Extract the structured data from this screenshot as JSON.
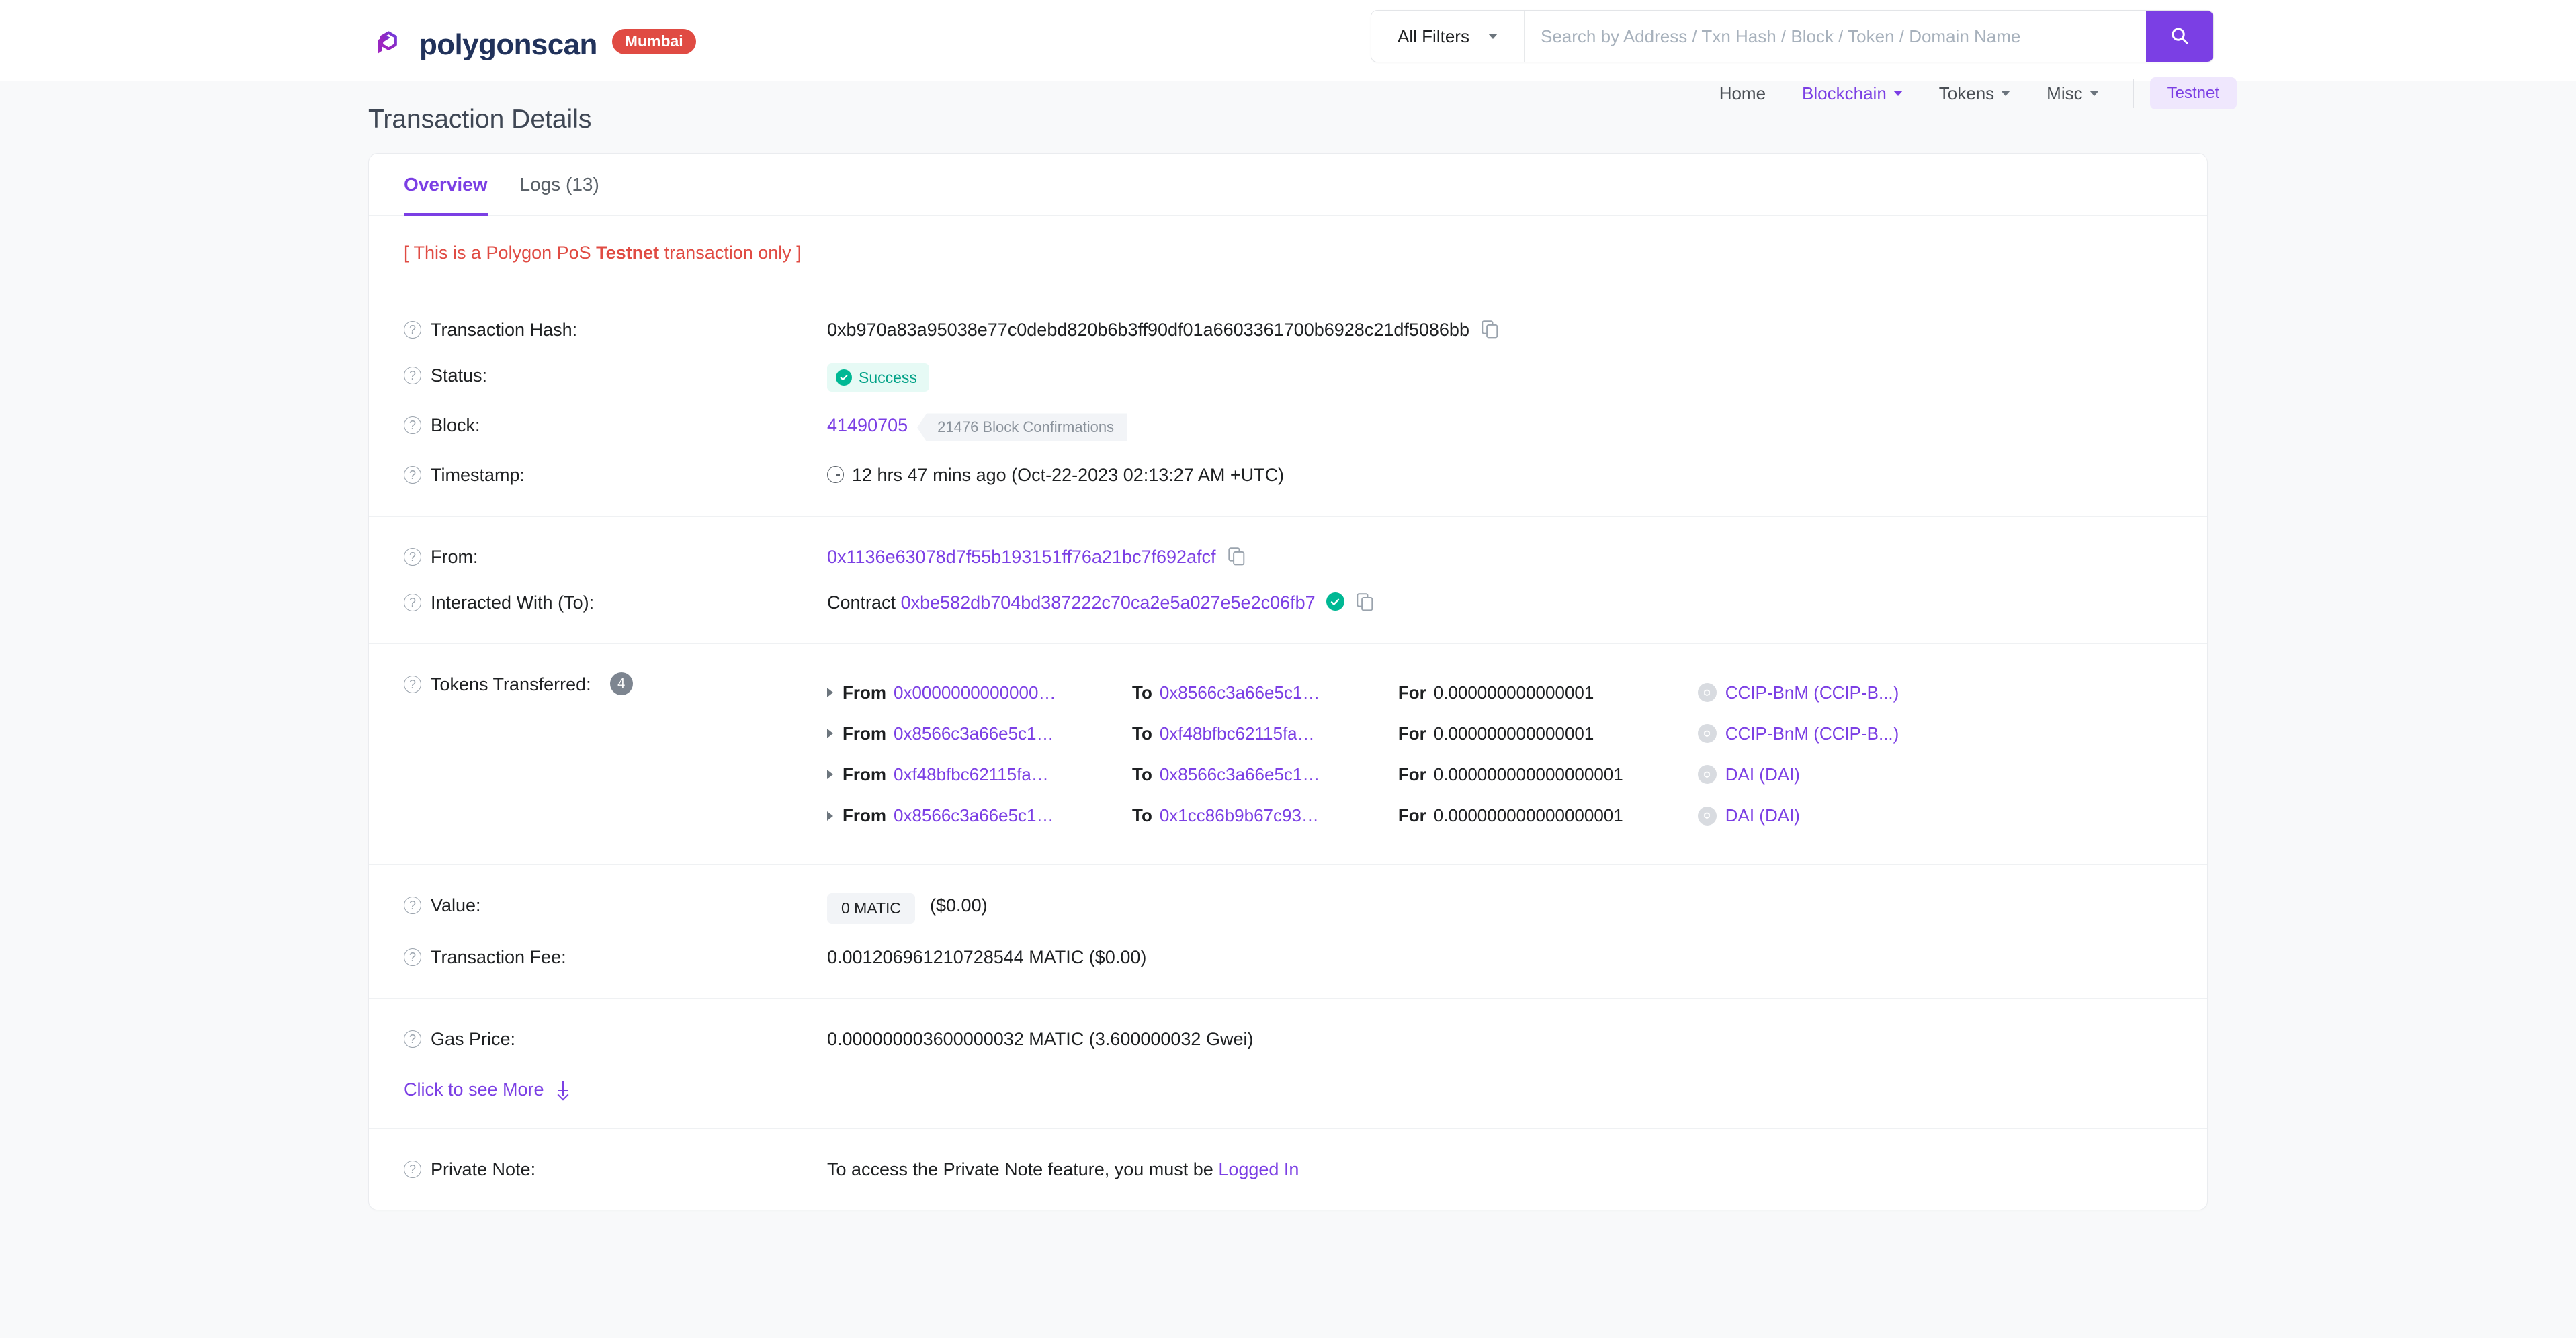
{
  "brand": {
    "name": "polygonscan",
    "network_badge": "Mumbai",
    "logo_icon": "polygon-logo-icon"
  },
  "search": {
    "filter_label": "All Filters",
    "placeholder": "Search by Address / Txn Hash / Block / Token / Domain Name",
    "value": "",
    "button_icon": "search-icon"
  },
  "nav": {
    "items": [
      {
        "label": "Home",
        "has_caret": false,
        "active": false
      },
      {
        "label": "Blockchain",
        "has_caret": true,
        "active": true
      },
      {
        "label": "Tokens",
        "has_caret": true,
        "active": false
      },
      {
        "label": "Misc",
        "has_caret": true,
        "active": false
      }
    ],
    "testnet_pill": "Testnet"
  },
  "page": {
    "title": "Transaction Details"
  },
  "tabs": [
    {
      "label": "Overview",
      "active": true
    },
    {
      "label": "Logs (13)",
      "active": false
    }
  ],
  "notice": {
    "prefix": "[ This is a Polygon PoS ",
    "strong": "Testnet",
    "suffix": " transaction only ]"
  },
  "details": {
    "transaction_hash": {
      "label": "Transaction Hash:",
      "value": "0xb970a83a95038e77c0debd820b6b3ff90df01a6603361700b6928c21df5086bb"
    },
    "status": {
      "label": "Status:",
      "value": "Success"
    },
    "block": {
      "label": "Block:",
      "number": "41490705",
      "confirmations": "21476 Block Confirmations"
    },
    "timestamp": {
      "label": "Timestamp:",
      "value": "12 hrs 47 mins ago (Oct-22-2023 02:13:27 AM +UTC)"
    },
    "from": {
      "label": "From:",
      "value": "0x1136e63078d7f55b193151ff76a21bc7f692afcf"
    },
    "interacted_with": {
      "label": "Interacted With (To):",
      "prefix": "Contract",
      "address": "0xbe582db704bd387222c70ca2e5a027e5e2c06fb7"
    },
    "tokens_transferred": {
      "label": "Tokens Transferred:",
      "count": "4",
      "rows": [
        {
          "from_key": "From",
          "from": "0x0000000000000…",
          "to_key": "To",
          "to": "0x8566c3a66e5c1…",
          "for_key": "For",
          "amount": "0.000000000000001",
          "token": "CCIP-BnM (CCIP-B...)"
        },
        {
          "from_key": "From",
          "from": "0x8566c3a66e5c1…",
          "to_key": "To",
          "to": "0xf48bfbc62115fa…",
          "for_key": "For",
          "amount": "0.000000000000001",
          "token": "CCIP-BnM (CCIP-B...)"
        },
        {
          "from_key": "From",
          "from": "0xf48bfbc62115fa…",
          "to_key": "To",
          "to": "0x8566c3a66e5c1…",
          "for_key": "For",
          "amount": "0.000000000000000001",
          "token": "DAI (DAI)"
        },
        {
          "from_key": "From",
          "from": "0x8566c3a66e5c1…",
          "to_key": "To",
          "to": "0x1cc86b9b67c93…",
          "for_key": "For",
          "amount": "0.000000000000000001",
          "token": "DAI (DAI)"
        }
      ]
    },
    "value": {
      "label": "Value:",
      "amount": "0 MATIC",
      "fiat": "($0.00)"
    },
    "transaction_fee": {
      "label": "Transaction Fee:",
      "value": "0.001206961210728544 MATIC ($0.00)"
    },
    "gas_price": {
      "label": "Gas Price:",
      "value": "0.000000003600000032 MATIC (3.600000032 Gwei)"
    },
    "see_more": {
      "label": "Click to see More"
    },
    "private_note": {
      "label": "Private Note:",
      "text": "To access the Private Note feature, you must be",
      "link": "Logged In"
    }
  },
  "colors": {
    "accent": "#7b3fe4",
    "brand_dark": "#21325b",
    "danger": "#e04b43",
    "success": "#00b894",
    "muted": "#8a929b"
  }
}
